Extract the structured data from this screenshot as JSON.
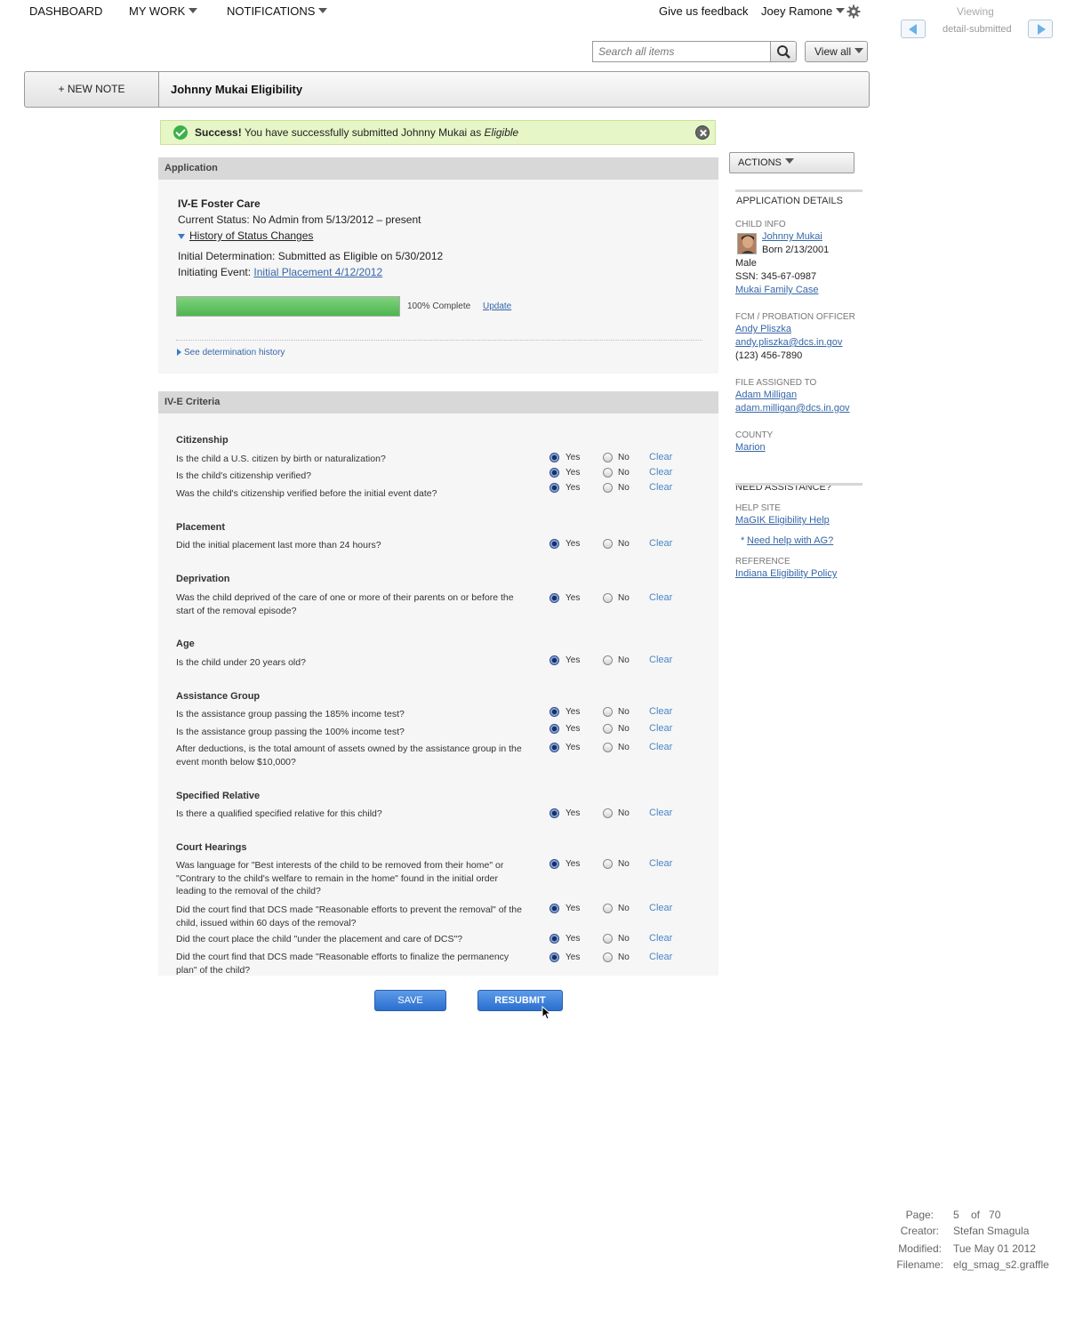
{
  "nav": {
    "dashboard": "DASHBOARD",
    "my_work": "MY WORK",
    "notifications": "NOTIFICATIONS",
    "feedback": "Give us feedback",
    "user": "Joey Ramone"
  },
  "viewing": {
    "label": "Viewing",
    "value": "detail-submitted"
  },
  "search": {
    "placeholder": "Search all items",
    "view_all": "View all"
  },
  "header": {
    "new_note": "+ NEW NOTE",
    "title": "Johnny Mukai Eligibility"
  },
  "success": {
    "bold": "Success!",
    "message": " You have successfully submitted Johnny Mukai as ",
    "status": "Eligible"
  },
  "application": {
    "section": "Application",
    "program": "IV-E Foster Care",
    "current_status": "Current Status: No Admin from 5/13/2012 – present",
    "history_link": "History of Status Changes",
    "initial_determination": "Initial Determination: Submitted as Eligible on 5/30/2012",
    "initiating_event_label": "Initiating Event: ",
    "initiating_event_link": "Initial Placement 4/12/2012",
    "progress_percent": 100,
    "progress_text": "100% Complete",
    "update_link": "Update",
    "determination_history": "See determination history"
  },
  "criteria": {
    "section": "IV-E Criteria",
    "yes_label": "Yes",
    "no_label": "No",
    "clear_label": "Clear",
    "groups": {
      "citizenship": {
        "title": "Citizenship",
        "q1": "Is the child a U.S. citizen by birth or naturalization?",
        "q2": "Is the child's citizenship verified?",
        "q3": "Was the child's citizenship verified before the initial event date?"
      },
      "placement": {
        "title": "Placement",
        "q1": "Did the initial placement last more than 24 hours?"
      },
      "deprivation": {
        "title": "Deprivation",
        "q1": "Was the child deprived of the care of one or more of their parents on or before the start of the removal episode?"
      },
      "age": {
        "title": "Age",
        "q1": "Is the child under 20 years old?"
      },
      "assistance": {
        "title": "Assistance Group",
        "q1": "Is the assistance group passing the 185% income test?",
        "q2": "Is the assistance group passing the 100% income test?",
        "q3": "After deductions, is the total amount of assets owned by the assistance group in the event month below $10,000?"
      },
      "relative": {
        "title": "Specified Relative",
        "q1": "Is there a qualified specified relative for this child?"
      },
      "court": {
        "title": "Court Hearings",
        "q1": "Was language for \"Best interests of the child to be removed from their home\" or \"Contrary to the child's welfare to remain in the home\" found in the initial order leading to the removal of the child?",
        "q2": "Did the court find that DCS made \"Reasonable efforts to prevent the removal\" of the child, issued within 60 days of the removal?",
        "q3": "Did the court place the child \"under the placement and care of DCS\"?",
        "q4": "Did the court find that DCS made \"Reasonable efforts to finalize the permanency plan\" of the child?"
      }
    },
    "all_answers": "Yes"
  },
  "buttons": {
    "save": "SAVE",
    "resubmit": "RESUBMIT"
  },
  "sidebar": {
    "actions": "ACTIONS",
    "app_details": "APPLICATION DETAILS",
    "child_info_label": "CHILD INFO",
    "child_name": "Johnny Mukai",
    "child_born": "Born 2/13/2001",
    "child_gender": "Male",
    "child_ssn": "SSN: 345-67-0987",
    "family_case": "Mukai Family Case",
    "fcm_label": "FCM / PROBATION OFFICER",
    "fcm_name": "Andy Pliszka",
    "fcm_email": "andy.pliszka@dcs.in.gov",
    "fcm_phone": "(123) 456-7890",
    "assigned_label": "FILE ASSIGNED TO",
    "assigned_name": "Adam Milligan",
    "assigned_email": "adam.milligan@dcs.in.gov",
    "county_label": "COUNTY",
    "county": "Marion",
    "assistance_head": "NEED ASSISTANCE?",
    "help_label": "HELP SITE",
    "help_link": "MaGIK Eligibility Help",
    "ag_bullet": "*",
    "ag_link": "Need help with AG?",
    "reference_label": "REFERENCE",
    "reference_link": "Indiana Eligibility Policy"
  },
  "footer": {
    "page_label": "Page:",
    "page_value": "5    of   70",
    "creator_label": "Creator:",
    "creator": "Stefan Smagula",
    "modified_label": "Modified:",
    "modified": "Tue May 01 2012",
    "filename_label": "Filename:",
    "filename": "elg_smag_s2.graffle"
  },
  "colors": {
    "accent_blue": "#2a6fd0",
    "success_bg": "#e6f6c6",
    "progress_green": "#4eb54e"
  }
}
